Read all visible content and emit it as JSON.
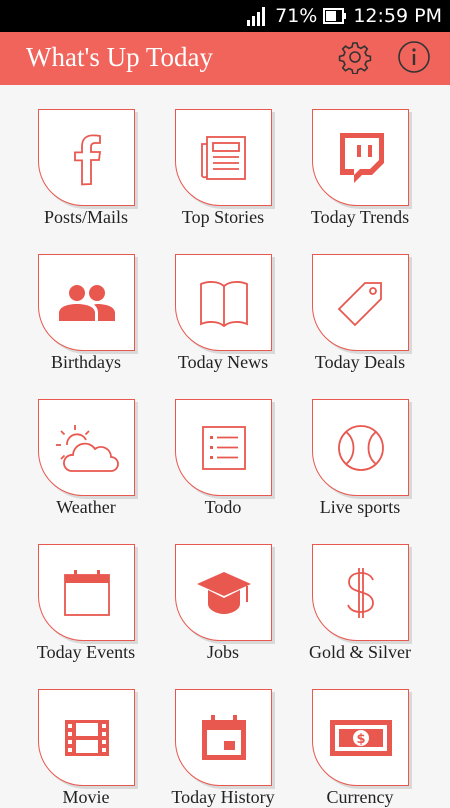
{
  "status_bar": {
    "battery": "71%",
    "time": "12:59 PM"
  },
  "app_bar": {
    "title": "What's Up Today",
    "settings_icon": "gear-icon",
    "info_icon": "info-icon"
  },
  "colors": {
    "accent": "#f0645c",
    "icon": "#e8584f"
  },
  "tiles": [
    {
      "label": "Posts/Mails",
      "icon": "facebook-icon"
    },
    {
      "label": "Top Stories",
      "icon": "newspaper-icon"
    },
    {
      "label": "Today Trends",
      "icon": "twitch-icon"
    },
    {
      "label": "Birthdays",
      "icon": "people-icon"
    },
    {
      "label": "Today News",
      "icon": "open-book-icon"
    },
    {
      "label": "Today Deals",
      "icon": "price-tag-icon"
    },
    {
      "label": "Weather",
      "icon": "sun-cloud-icon"
    },
    {
      "label": "Todo",
      "icon": "checklist-icon"
    },
    {
      "label": "Live sports",
      "icon": "ball-icon"
    },
    {
      "label": "Today Events",
      "icon": "calendar-icon"
    },
    {
      "label": "Jobs",
      "icon": "graduation-cap-icon"
    },
    {
      "label": "Gold & Silver",
      "icon": "dollar-icon"
    },
    {
      "label": "Movie",
      "icon": "film-icon"
    },
    {
      "label": "Today History",
      "icon": "calendar-date-icon"
    },
    {
      "label": "Currency",
      "icon": "banknote-icon"
    }
  ]
}
